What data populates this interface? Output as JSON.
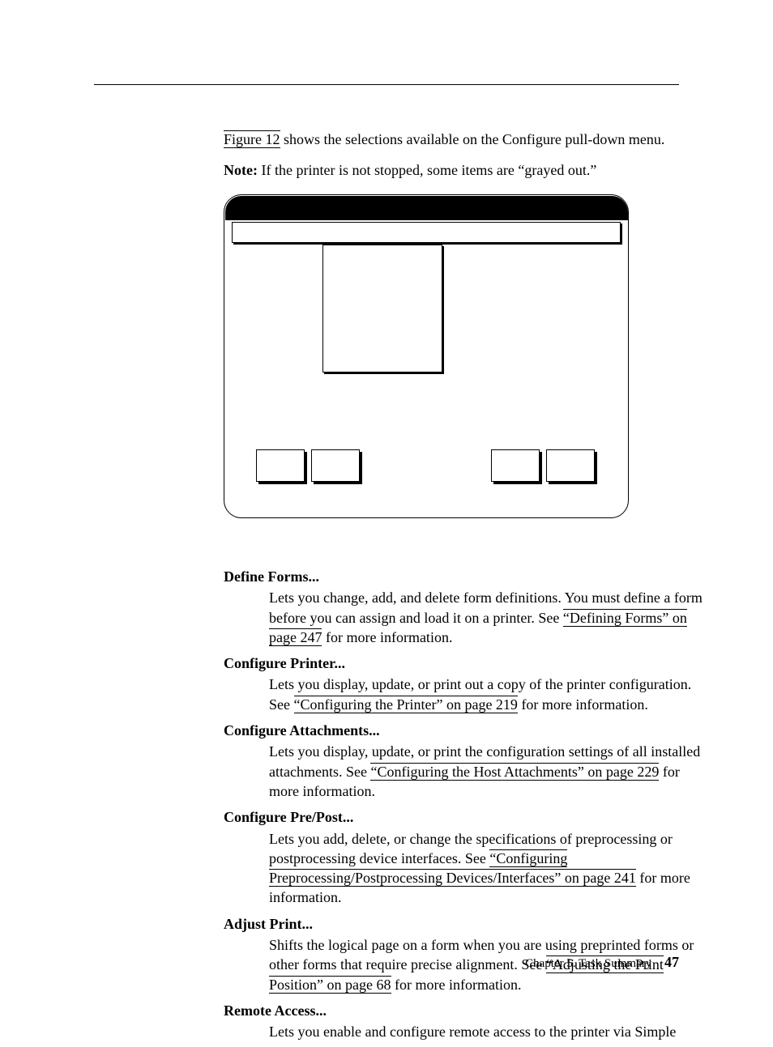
{
  "intro": {
    "figref": "Figure 12",
    "intro_tail": " shows the selections available on the Configure pull-down menu.",
    "note_label": "Note:",
    "note_body": " If the printer is not stopped, some items are “grayed out.”"
  },
  "definitions": [
    {
      "term": "Define Forms...",
      "body_pre": "Lets you change, add, and delete form definitions. You must define a form before you can assign and load it on a printer. See ",
      "xref": "“Defining Forms” on page 247",
      "body_post": " for more information."
    },
    {
      "term": "Configure Printer...",
      "body_pre": "Lets you display, update, or print out a copy of the printer configuration. See ",
      "xref": "“Configuring the Printer” on page 219",
      "body_post": " for more information."
    },
    {
      "term": "Configure Attachments...",
      "body_pre": "Lets you display, update, or print the configuration settings of all installed attachments. See ",
      "xref": "“Configuring the Host Attachments” on page 229",
      "body_post": " for more information."
    },
    {
      "term": "Configure Pre/Post...",
      "body_pre": "Lets you add, delete, or change the specifications of preprocessing or postprocessing device interfaces. See ",
      "xref": "“Configuring Preprocessing/Postprocessing Devices/Interfaces” on page 241",
      "body_post": " for more information."
    },
    {
      "term": "Adjust Print...",
      "body_pre": "Shifts the logical page on a form when you are using preprinted forms or other forms that require precise alignment. See ",
      "xref": "“Adjusting the Print Position” on page 68",
      "body_post": " for more information."
    },
    {
      "term": "Remote Access...",
      "body_pre": "Lets you enable and configure remote access to the printer via Simple",
      "xref": "",
      "body_post": ""
    }
  ],
  "footer": {
    "chapter": "Chapter 5. Task Summary",
    "page": "47"
  }
}
